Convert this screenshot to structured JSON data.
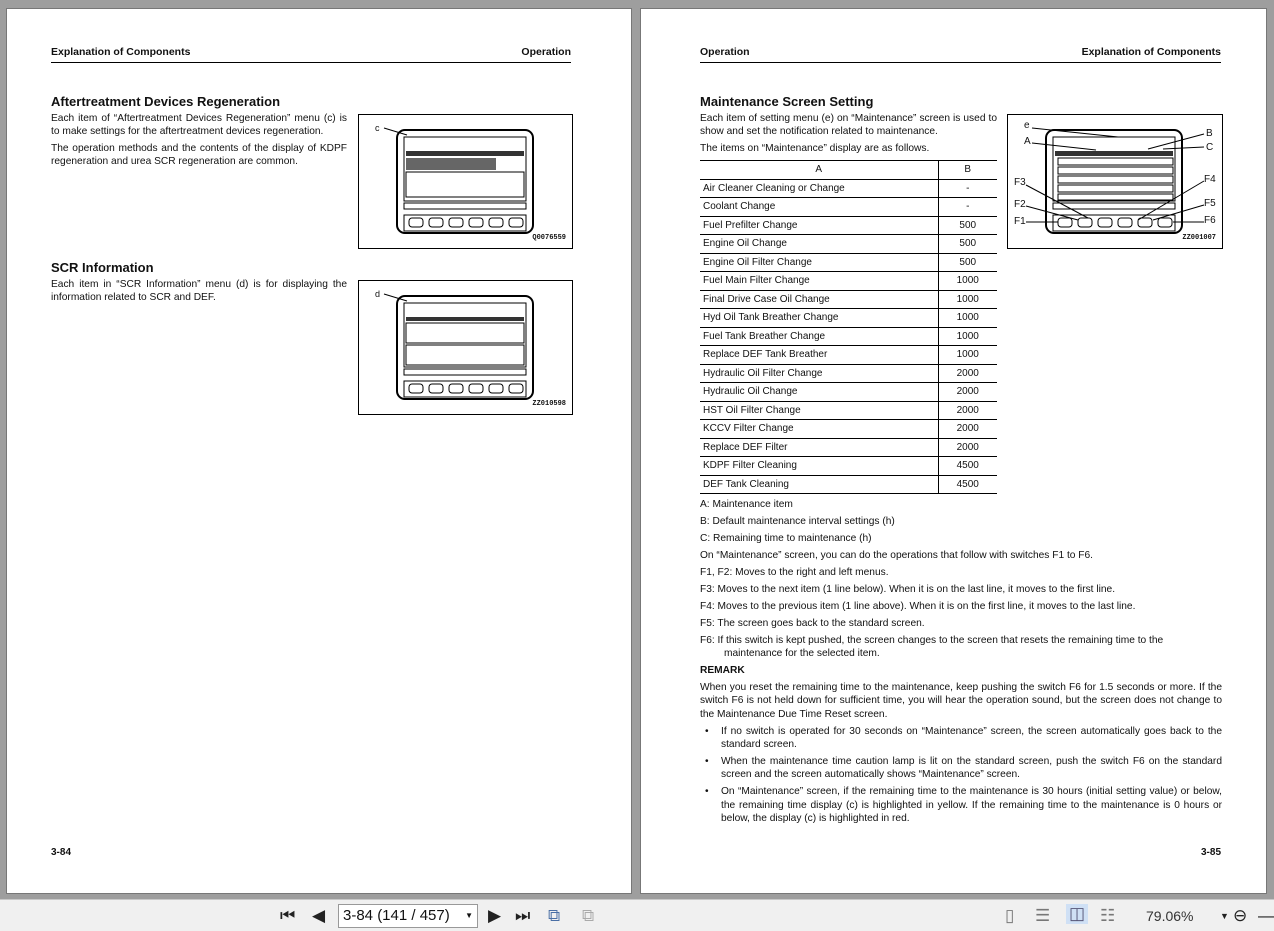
{
  "left_page": {
    "header_left": "Explanation of Components",
    "header_right": "Operation",
    "sec1_title": "Aftertreatment Devices Regeneration",
    "sec1_p1": "Each item of “Aftertreatment Devices Regeneration” menu (c) is to make settings for the aftertreatment devices regeneration.",
    "sec1_p2": "The operation methods and the contents of the display of KDPF regeneration and urea SCR regeneration are common.",
    "fig1_label": "c",
    "fig1_code": "Q0076559",
    "sec2_title": "SCR Information",
    "sec2_p1": "Each item in “SCR Information” menu (d) is for displaying the information related to SCR and DEF.",
    "fig2_label": "d",
    "fig2_code": "ZZ010598",
    "page_number": "3-84"
  },
  "right_page": {
    "header_left": "Operation",
    "header_right": "Explanation of Components",
    "title": "Maintenance Screen Setting",
    "intro1": "Each item of setting menu (e) on “Maintenance” screen is used to show and set the notification related to maintenance.",
    "intro2": "The items on “Maintenance” display are as follows.",
    "fig_labels": {
      "e": "e",
      "A": "A",
      "B": "B",
      "C": "C",
      "F1": "F1",
      "F2": "F2",
      "F3": "F3",
      "F4": "F4",
      "F5": "F5",
      "F6": "F6"
    },
    "fig_code": "ZZ001007",
    "table": {
      "col_a": "A",
      "col_b": "B",
      "rows": [
        [
          "Air Cleaner Cleaning or Change",
          "-"
        ],
        [
          "Coolant Change",
          "-"
        ],
        [
          "Fuel Prefilter Change",
          "500"
        ],
        [
          "Engine Oil Change",
          "500"
        ],
        [
          "Engine Oil Filter Change",
          "500"
        ],
        [
          "Fuel Main Filter Change",
          "1000"
        ],
        [
          "Final Drive Case Oil Change",
          "1000"
        ],
        [
          "Hyd Oil Tank Breather Change",
          "1000"
        ],
        [
          "Fuel Tank Breather Change",
          "1000"
        ],
        [
          "Replace DEF Tank Breather",
          "1000"
        ],
        [
          "Hydraulic Oil Filter Change",
          "2000"
        ],
        [
          "Hydraulic Oil Change",
          "2000"
        ],
        [
          "HST Oil Filter Change",
          "2000"
        ],
        [
          "KCCV Filter Change",
          "2000"
        ],
        [
          "Replace DEF Filter",
          "2000"
        ],
        [
          "KDPF Filter Cleaning",
          "4500"
        ],
        [
          "DEF Tank Cleaning",
          "4500"
        ]
      ]
    },
    "lines": [
      "A: Maintenance item",
      "B: Default maintenance interval settings (h)",
      "C: Remaining time to maintenance (h)",
      "On “Maintenance” screen, you can do the operations that follow with switches F1 to F6.",
      "F1, F2: Moves to the right and left menus.",
      "F3: Moves to the next item (1 line below). When it is on the last line, it moves to the first line.",
      "F4: Moves to the previous item (1 line above). When it is on the first line, it moves to the last line.",
      "F5: The screen goes back to the standard screen.",
      "F6: If this switch is kept pushed, the screen changes to the screen that resets the remaining time to the maintenance for the selected item."
    ],
    "remark_title": "REMARK",
    "remark": "When you reset the remaining time to the maintenance, keep pushing the switch F6 for 1.5 seconds or more. If the switch F6 is not held down for sufficient time, you will hear the operation sound, but the screen does not change to the Maintenance Due Time Reset screen.",
    "bullets": [
      "If no switch is operated for 30 seconds on “Maintenance” screen, the screen automatically goes back to the standard screen.",
      "When the maintenance time caution lamp is lit on the standard screen, push the switch F6 on the standard screen and the screen automatically shows “Maintenance” screen.",
      "On “Maintenance” screen, if the remaining time to the maintenance is 30 hours (initial setting value) or below, the remaining time display (c) is highlighted in yellow. If the remaining time to the maintenance is 0 hours or below, the display (c) is highlighted in red."
    ],
    "page_number": "3-85"
  },
  "toolbar": {
    "page_field": "3-84 (141 / 457)",
    "zoom": "79.06%"
  }
}
